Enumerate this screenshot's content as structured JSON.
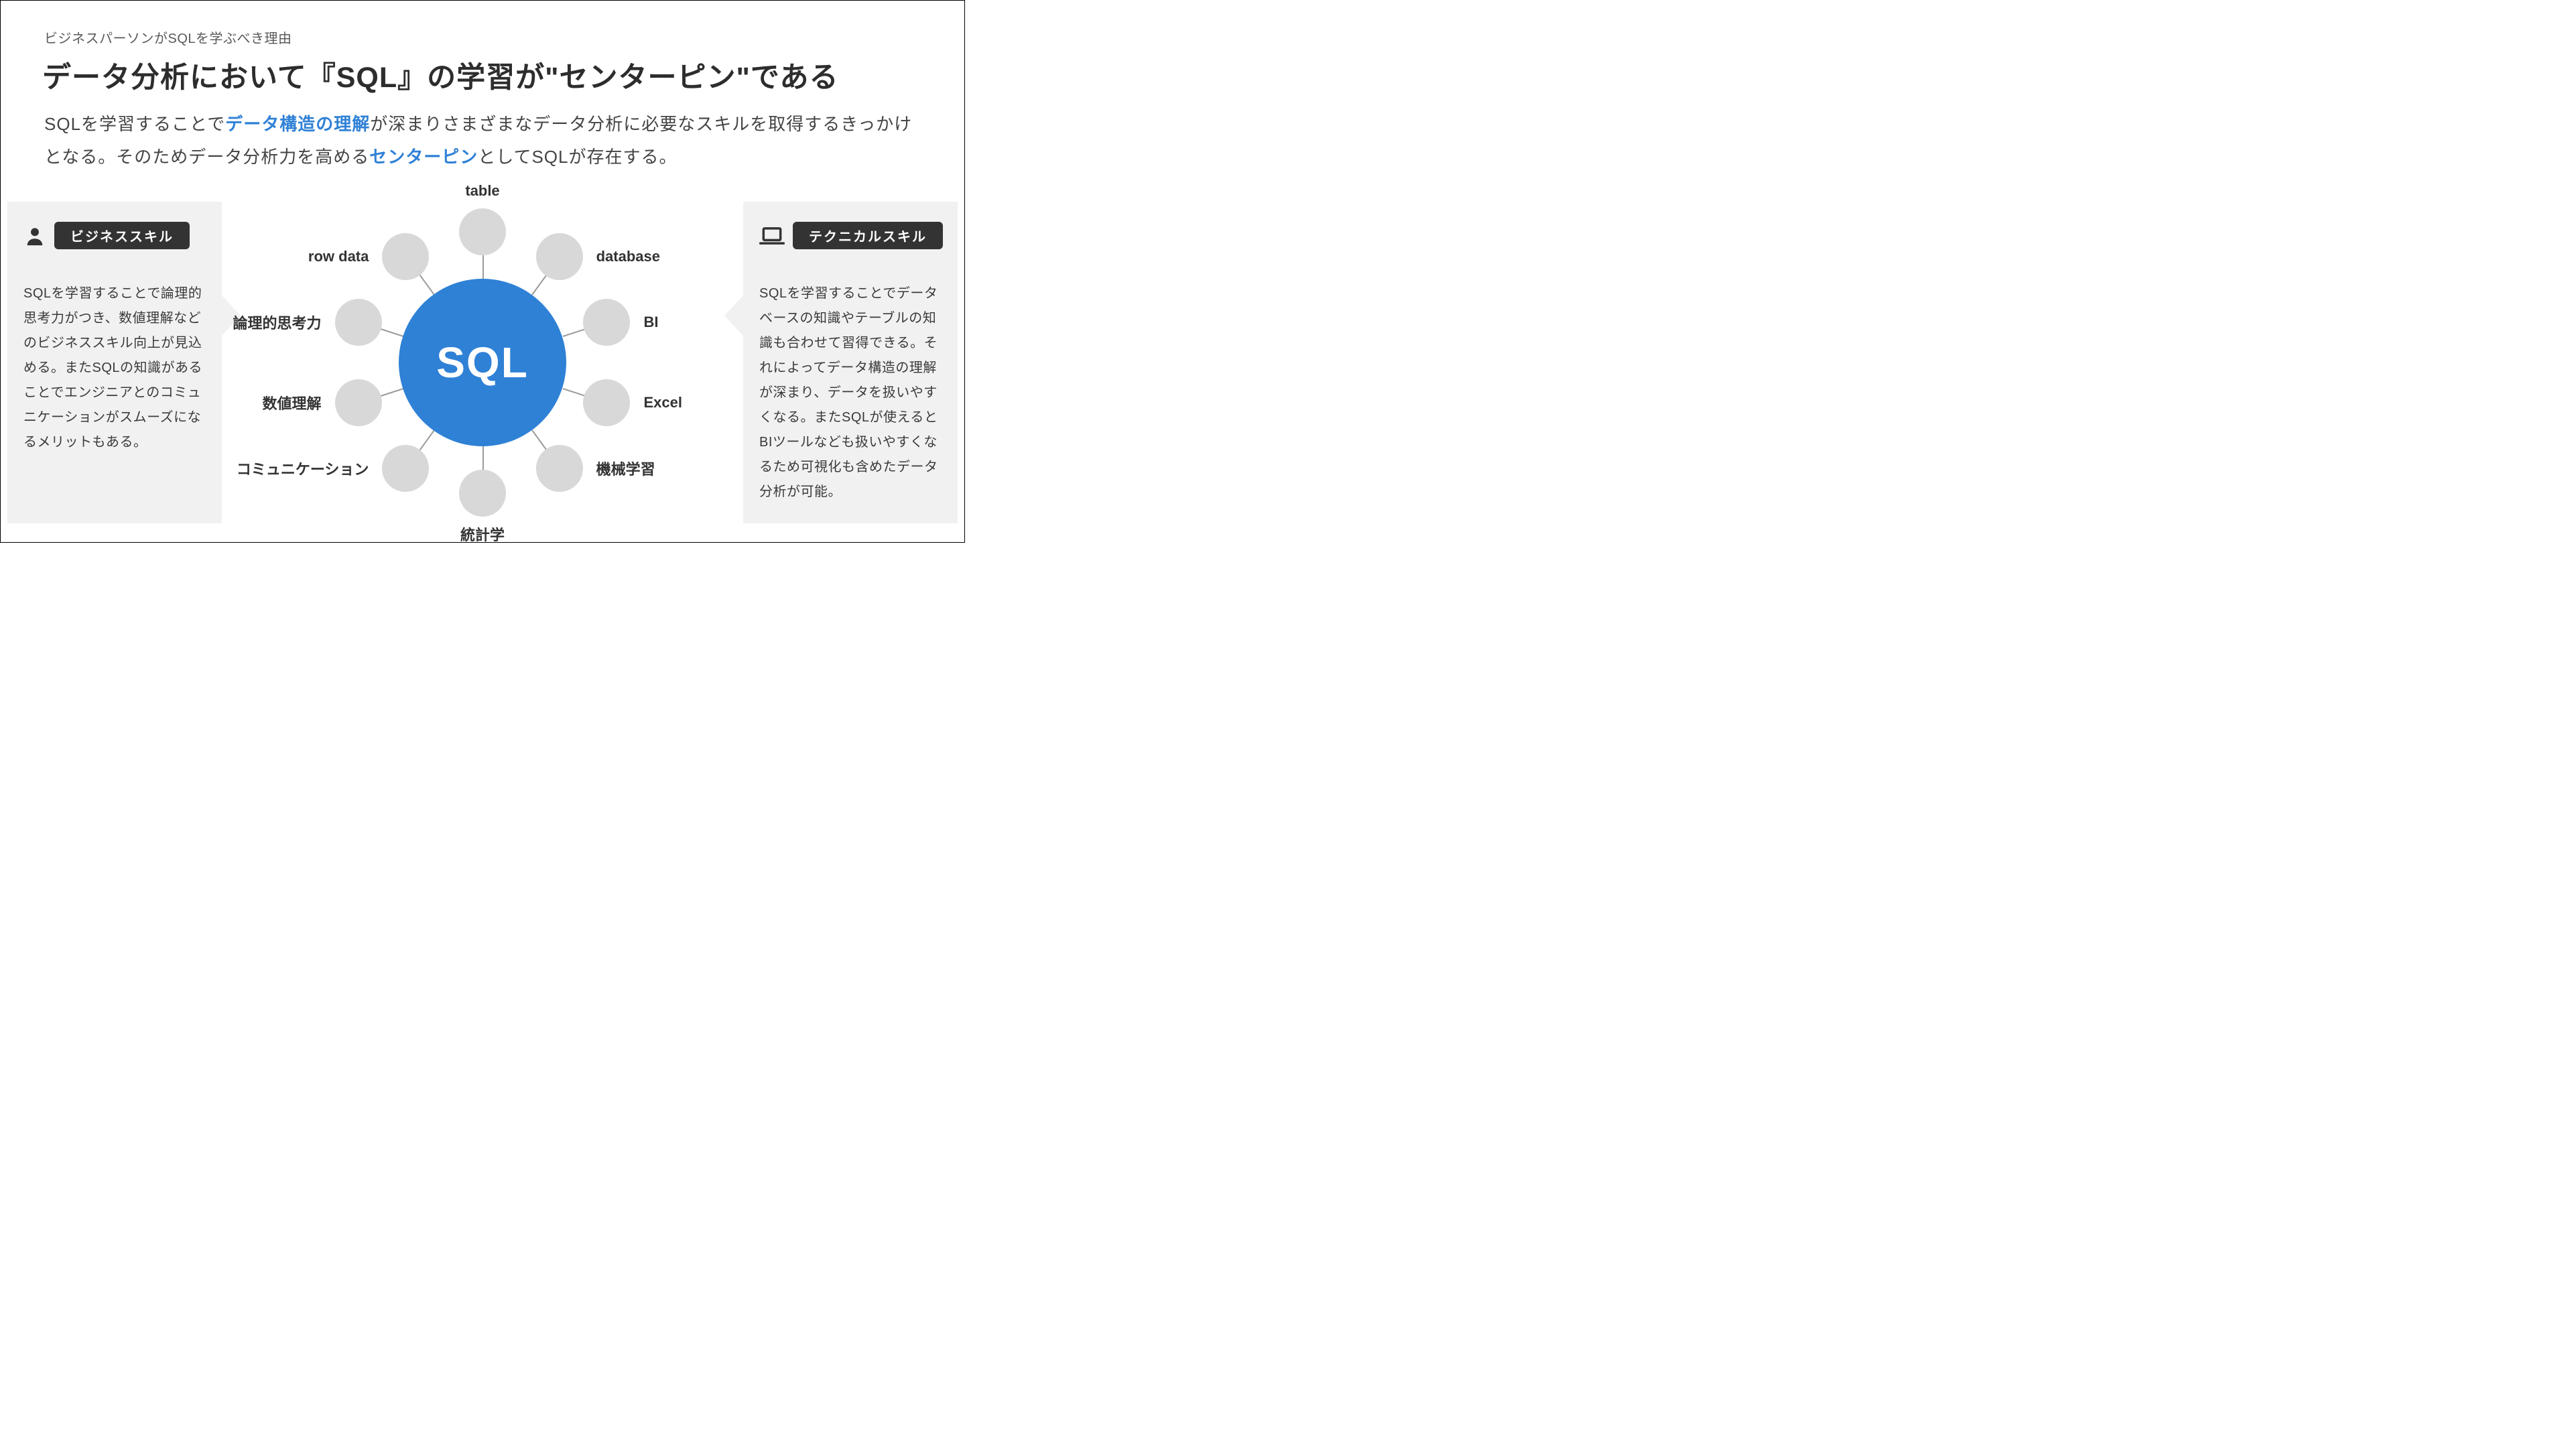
{
  "eyebrow": "ビジネスパーソンがSQLを学ぶべき理由",
  "headline": "データ分析において『SQL』の学習が\"センターピン\"である",
  "lead": {
    "p1a": "SQLを学習することで",
    "hl1": "データ構造の理解",
    "p1b": "が深まりさまざまなデータ分析に必要なスキルを取得するきっかけとなる。そのためデータ分析力を高める",
    "hl2": "センターピン",
    "p1c": "としてSQLが存在する。"
  },
  "left_card": {
    "title": "ビジネススキル",
    "body": "SQLを学習することで論理的思考力がつき、数値理解などのビジネススキル向上が見込める。またSQLの知識があることでエンジニアとのコミュニケーションがスムーズになるメリットもある。"
  },
  "right_card": {
    "title": "テクニカルスキル",
    "body": "SQLを学習することでデータベースの知識やテーブルの知識も合わせて習得できる。それによってデータ構造の理解が深まり、データを扱いやすくなる。またSQLが使えるとBIツールなども扱いやすくなるため可視化も含めたデータ分析が可能。"
  },
  "hub": "SQL",
  "nodes": [
    {
      "label": "table",
      "angle": -90,
      "r": 195,
      "labelSide": "above"
    },
    {
      "label": "database",
      "angle": -54,
      "r": 195,
      "labelSide": "right"
    },
    {
      "label": "BI",
      "angle": -18,
      "r": 195,
      "labelSide": "right"
    },
    {
      "label": "Excel",
      "angle": 18,
      "r": 195,
      "labelSide": "right"
    },
    {
      "label": "機械学習",
      "angle": 54,
      "r": 195,
      "labelSide": "right"
    },
    {
      "label": "統計学",
      "angle": 90,
      "r": 195,
      "labelSide": "below"
    },
    {
      "label": "コミュニケーション",
      "angle": 126,
      "r": 195,
      "labelSide": "left"
    },
    {
      "label": "数値理解",
      "angle": 162,
      "r": 195,
      "labelSide": "left"
    },
    {
      "label": "論理的思考力",
      "angle": 198,
      "r": 195,
      "labelSide": "left"
    },
    {
      "label": "row data",
      "angle": 234,
      "r": 195,
      "labelSide": "left"
    }
  ],
  "colors": {
    "accent": "#2f81d6",
    "grey_node": "#d8d8d8",
    "card_bg": "#f1f1f1",
    "pill_bg": "#333333"
  }
}
